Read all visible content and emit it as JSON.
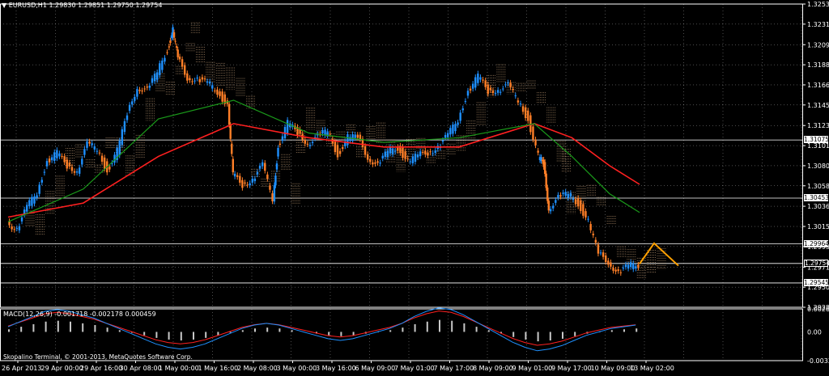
{
  "header": {
    "symbol_label": "EURUSD,H1",
    "ohlc": "1.29830 1.29851 1.29750 1.29754"
  },
  "macd_label": "MACD(12,26,9) -0.001718 -0.002178 0.000459",
  "copyright": "Skopalino Terminal, © 2001-2013, MetaQuotes Software Corp.",
  "colors": {
    "background": "#000000",
    "grid": "#ffffff",
    "candle_bull": "#1e90ff",
    "candle_bear": "#ff7f27",
    "ma_red": "#ff2020",
    "ma_green": "#1a9a1a",
    "cloud": "#c9a27a",
    "histogram": "#c8c8c8",
    "macd_signal": "#ff2020",
    "macd_line": "#1e90ff",
    "zigzag": "#ffa000"
  },
  "chart_data": [
    {
      "type": "line",
      "panel": "price",
      "y_ticks": [
        "1.32530",
        "1.32315",
        "1.32095",
        "1.31880",
        "1.31665",
        "1.31450",
        "1.31230",
        "1.31015",
        "1.30800",
        "1.30585",
        "1.30366",
        "1.30150",
        "1.29935",
        "1.29715",
        "1.29500",
        "1.29285"
      ],
      "ylim": [
        1.29285,
        1.3253
      ],
      "x_ticks": [
        "26 Apr 2013",
        "29 Apr 00:00",
        "29 Apr 16:00",
        "30 Apr 08:00",
        "1 May 00:00",
        "1 May 16:00",
        "2 May 08:00",
        "3 May 00:00",
        "3 May 16:00",
        "6 May 09:00",
        "7 May 01:00",
        "7 May 17:00",
        "8 May 09:00",
        "9 May 01:00",
        "9 May 17:00",
        "10 May 09:00",
        "13 May 02:00"
      ],
      "horizontal_levels": [
        {
          "label": "1.31075",
          "value": 1.31075
        },
        {
          "label": "1.30453",
          "value": 1.30453
        },
        {
          "label": "1.29964",
          "value": 1.29964
        },
        {
          "label": "1.29754",
          "value": 1.29754
        },
        {
          "label": "1.29545",
          "value": 1.29545
        }
      ],
      "current_price": "1.29754",
      "price_path": [
        [
          0,
          1.302
        ],
        [
          8,
          1.3012
        ],
        [
          16,
          1.3035
        ],
        [
          24,
          1.3052
        ],
        [
          32,
          1.3085
        ],
        [
          40,
          1.3093
        ],
        [
          48,
          1.308
        ],
        [
          56,
          1.3075
        ],
        [
          64,
          1.3102
        ],
        [
          72,
          1.3098
        ],
        [
          80,
          1.3075
        ],
        [
          88,
          1.3095
        ],
        [
          96,
          1.3135
        ],
        [
          104,
          1.3165
        ],
        [
          112,
          1.316
        ],
        [
          120,
          1.318
        ],
        [
          128,
          1.3205
        ],
        [
          132,
          1.3225
        ],
        [
          136,
          1.3195
        ],
        [
          144,
          1.3175
        ],
        [
          152,
          1.3172
        ],
        [
          160,
          1.3168
        ],
        [
          168,
          1.316
        ],
        [
          176,
          1.3145
        ],
        [
          180,
          1.307
        ],
        [
          188,
          1.306
        ],
        [
          196,
          1.3066
        ],
        [
          204,
          1.308
        ],
        [
          212,
          1.3045
        ],
        [
          216,
          1.31
        ],
        [
          224,
          1.3125
        ],
        [
          232,
          1.3115
        ],
        [
          240,
          1.3105
        ],
        [
          248,
          1.311
        ],
        [
          256,
          1.3118
        ],
        [
          264,
          1.3092
        ],
        [
          272,
          1.311
        ],
        [
          280,
          1.311
        ],
        [
          288,
          1.309
        ],
        [
          296,
          1.308
        ],
        [
          304,
          1.3095
        ],
        [
          312,
          1.31
        ],
        [
          320,
          1.3085
        ],
        [
          328,
          1.309
        ],
        [
          336,
          1.3095
        ],
        [
          344,
          1.31
        ],
        [
          352,
          1.3112
        ],
        [
          360,
          1.313
        ],
        [
          368,
          1.316
        ],
        [
          376,
          1.3175
        ],
        [
          384,
          1.316
        ],
        [
          392,
          1.3162
        ],
        [
          400,
          1.3165
        ],
        [
          408,
          1.315
        ],
        [
          416,
          1.313
        ],
        [
          424,
          1.309
        ],
        [
          428,
          1.308
        ],
        [
          432,
          1.3035
        ],
        [
          440,
          1.3045
        ],
        [
          448,
          1.305
        ],
        [
          456,
          1.304
        ],
        [
          464,
          1.302
        ],
        [
          472,
          1.2985
        ],
        [
          480,
          1.2978
        ],
        [
          488,
          1.2965
        ],
        [
          496,
          1.2972
        ],
        [
          504,
          1.2975
        ]
      ],
      "series": [
        {
          "name": "",
          "color": "#ff2020",
          "values": [
            [
              0,
              1.3025
            ],
            [
              60,
              1.304
            ],
            [
              120,
              1.309
            ],
            [
              180,
              1.3125
            ],
            [
              240,
              1.311
            ],
            [
              300,
              1.31
            ],
            [
              360,
              1.31
            ],
            [
              420,
              1.3125
            ],
            [
              450,
              1.311
            ],
            [
              480,
              1.308
            ],
            [
              504,
              1.306
            ]
          ]
        },
        {
          "name": "",
          "color": "#1a9a1a",
          "values": [
            [
              0,
              1.302
            ],
            [
              60,
              1.3055
            ],
            [
              120,
              1.313
            ],
            [
              180,
              1.315
            ],
            [
              240,
              1.3115
            ],
            [
              300,
              1.3105
            ],
            [
              360,
              1.311
            ],
            [
              420,
              1.3125
            ],
            [
              450,
              1.309
            ],
            [
              480,
              1.305
            ],
            [
              504,
              1.303
            ]
          ]
        }
      ],
      "grid": true
    },
    {
      "type": "bar",
      "panel": "macd",
      "y_ticks": [
        "0.002686",
        "0.00",
        "-0.003356"
      ],
      "ylim": [
        -0.003356,
        0.002686
      ],
      "histogram": [
        0.0003,
        0.0006,
        0.0009,
        0.0012,
        0.0013,
        0.0012,
        0.001,
        0.0008,
        0.0005,
        0.0002,
        -0.0001,
        -0.0004,
        -0.0007,
        -0.0009,
        -0.001,
        -0.0009,
        -0.0007,
        -0.0004,
        -0.0001,
        0.0002,
        0.0004,
        0.0005,
        0.0004,
        0.0002,
        0.0,
        -0.0002,
        -0.0004,
        -0.0005,
        -0.0004,
        -0.0002,
        0.0,
        0.0002,
        0.0005,
        0.0009,
        0.0012,
        0.0014,
        0.0013,
        0.001,
        0.0006,
        0.0002,
        -0.0002,
        -0.0006,
        -0.0009,
        -0.0011,
        -0.001,
        -0.0008,
        -0.0005,
        -0.0002,
        0.0,
        0.0002,
        0.0003,
        0.0004
      ]
    }
  ]
}
